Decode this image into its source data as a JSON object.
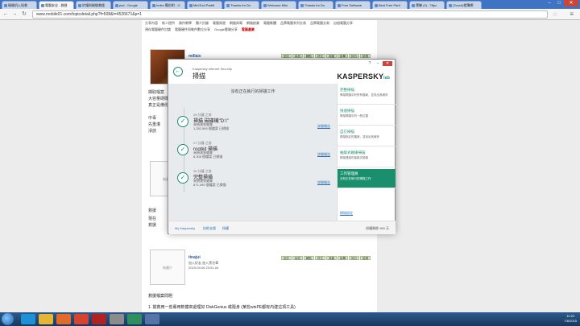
{
  "browser": {
    "tabs": [
      {
        "label": "磁碟机入肌救",
        "active": false
      },
      {
        "label": "電腦安全 - 救救",
        "active": true
      },
      {
        "label": "於讓與磁碟救援",
        "active": false
      },
      {
        "label": "psd - Google",
        "active": false
      },
      {
        "label": "Index 備份附 - G",
        "active": false
      },
      {
        "label": "MiniTool Partiti",
        "active": false
      },
      {
        "label": "Thanks for Do",
        "active": false
      },
      {
        "label": "Welcome Mini",
        "active": false
      },
      {
        "label": "Thanks for Do",
        "active": false
      },
      {
        "label": "Free Software",
        "active": false
      },
      {
        "label": "Best Free Parti",
        "active": false
      },
      {
        "label": "寶聯 (2) - 78pc",
        "active": false
      },
      {
        "label": "(Touch)相簿網",
        "active": false
      }
    ],
    "url": "www.mobile01.com/topicdetail.php?f=508&t=4526671&p=1"
  },
  "forum": {
    "nav_row1": [
      "分享內容",
      "新人提供",
      "操作教學",
      "簡介討論",
      "電腦周邊",
      "網路與電",
      "網路創業",
      "電腦軟體",
      "品牌電腦系列交易",
      "品牌電腦交易",
      "自組電腦分享"
    ],
    "nav_row2": [
      "預存電腦硬件討論",
      "電腦硬件與軟件數位分享",
      "Google雲端分享",
      "電腦產業"
    ],
    "post1": {
      "username": "millais",
      "tools": [
        "回文",
        "私訊",
        "轉貼",
        "好文",
        "收藏",
        "檢舉",
        "評分",
        "檢視"
      ],
      "snippets": [
        "擷取檔案",
        "大容量硬碟",
        "真正是備份",
        "中毒",
        "先重灌",
        "淨該"
      ]
    },
    "post2": {
      "avatar_label": "無圖片",
      "tools": [
        "回文",
        "私訊",
        "轉貼",
        "好文",
        "收藏",
        "檢舉",
        "評分",
        "檢視"
      ],
      "snippets": [
        "救援",
        "現在",
        "救援"
      ]
    },
    "post3": {
      "avatar_label": "無圖片",
      "username": "tinajui",
      "line1": "加入好友  加入黑名單",
      "line2": "2015-09-06 23:51  #4",
      "tools": [
        "回文",
        "私訊",
        "轉貼",
        "好文",
        "收藏",
        "檢舉",
        "評分",
        "檢視"
      ],
      "text1": "救援檔案問題",
      "text2": "1. 搶救用一些專用軟體來處理好  DiskGenius 或隨身 (某些winPE都有內建這項工具)"
    }
  },
  "kis": {
    "product": "Kaspersky Internet Security",
    "title": "掃描",
    "logo": "KASPERSKY",
    "logo_suffix": "lab",
    "status": "沒有正在執行的掃描工作",
    "tasks": [
      {
        "when": "28 分鐘 之前",
        "name": "掃描 磁碟機\"D:\\\"",
        "result": "未偵測到威脅",
        "count": "1,282,860 個檔案 已掃描",
        "report": "詳細報告"
      },
      {
        "when": "27 分鐘 之前",
        "name": "rootkit 掃描",
        "result": "未偵測到威脅",
        "count": "8,308 個檔案 已掃描",
        "report": "詳細報告"
      },
      {
        "when": "35 分鐘 之前",
        "name": "完整掃描",
        "result": "未偵測到威脅",
        "count": "871,090 個檔案 已掃描",
        "report": "詳細報告"
      }
    ],
    "side": [
      {
        "title": "完整掃描",
        "desc": "掃描電腦中的所有檔案，並找出其威脅",
        "active": false
      },
      {
        "title": "快速掃描",
        "desc": "掃描電腦中的一般位置",
        "active": false
      },
      {
        "title": "自訂掃描",
        "desc": "掃描指定的檔案，並找出其威脅",
        "active": false
      },
      {
        "title": "抽取式磁碟掃描",
        "desc": "掃描連接的抽取式磁碟",
        "active": false
      },
      {
        "title": "工作管理員",
        "desc": "沒有正在執行的掃描工作",
        "active": true
      }
    ],
    "side_link": "掃描設定",
    "footer": {
      "my_kaspersky": "My Kaspersky",
      "support": "技術支援",
      "license": "授權",
      "remaining": "授權剩餘 365 天"
    }
  },
  "taskbar": {
    "time": "10:22",
    "date": "7/6/2015"
  },
  "colors": {
    "kaspersky_green": "#1a8f6e",
    "chrome_blue": "#3f73c3"
  }
}
